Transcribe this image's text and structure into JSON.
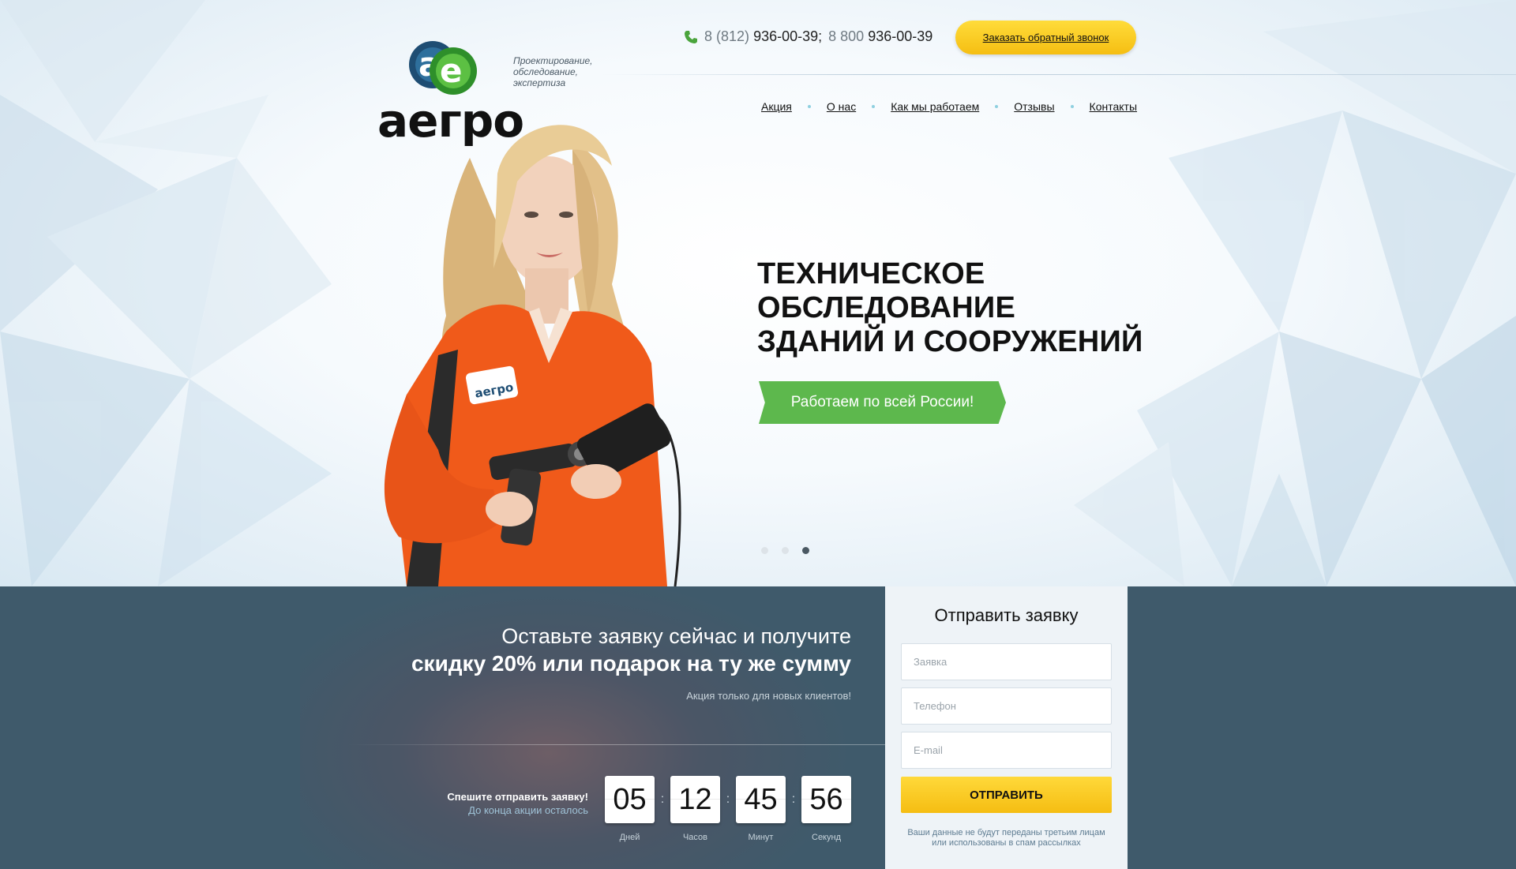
{
  "brand": {
    "name": "аегро",
    "logo_letters": "ae",
    "tagline": [
      "Проектирование,",
      "обследование,",
      "экспертиза"
    ]
  },
  "contacts": {
    "phone1_code": "8 (812)",
    "phone1_number": "936-00-39;",
    "phone2_code": "8 800",
    "phone2_number": "936-00-39",
    "callback_label": "Заказать обратный звонок"
  },
  "nav": {
    "items": [
      {
        "label": "Акция"
      },
      {
        "label": "О нас"
      },
      {
        "label": "Как мы работаем"
      },
      {
        "label": "Отзывы"
      },
      {
        "label": "Контакты"
      }
    ]
  },
  "hero": {
    "headline": [
      "ТЕХНИЧЕСКОЕ",
      "ОБСЛЕДОВАНИЕ",
      "ЗДАНИЙ И СООРУЖЕНИЙ"
    ],
    "ribbon": "Работаем по всей России!",
    "badge_text": "аегро",
    "slides_total": 3,
    "active_slide": 3
  },
  "offer": {
    "line1": "Оставьте заявку сейчас и получите",
    "line2": "скидку 20% или подарок на ту же сумму",
    "note": "Акция только для новых клиентов!",
    "hurry_title": "Спешите отправить заявку!",
    "hurry_sub": "До конца акции осталось"
  },
  "countdown": [
    {
      "value": "05",
      "label": "Дней"
    },
    {
      "value": "12",
      "label": "Часов"
    },
    {
      "value": "45",
      "label": "Минут"
    },
    {
      "value": "56",
      "label": "Секунд"
    }
  ],
  "form": {
    "title": "Отправить заявку",
    "request_placeholder": "Заявка",
    "phone_placeholder": "Телефон",
    "email_placeholder": "E-mail",
    "submit_label": "ОТПРАВИТЬ",
    "privacy_note": [
      "Ваши данные не будут переданы третьим лицам",
      "или использованы в спам рассылках"
    ]
  },
  "colors": {
    "accent_yellow": "#f5be12",
    "green": "#5db84d",
    "band": "#3f5a6b",
    "orange_suit": "#f05a1a"
  }
}
